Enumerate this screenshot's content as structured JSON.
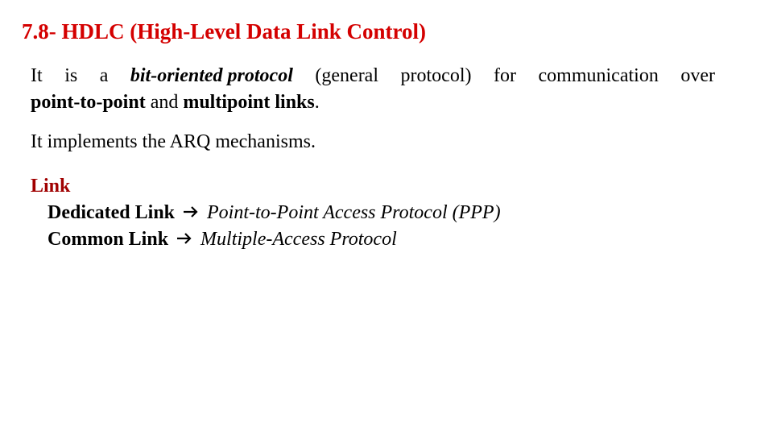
{
  "slide": {
    "title": "7.8- HDLC (High-Level Data Link Control)",
    "title_color": "#d40000",
    "paragraph1": {
      "words_line1": [
        "It",
        "is",
        "a",
        "bit-oriented protocol",
        "(general",
        "protocol)",
        "for",
        "communication",
        "over"
      ],
      "bold_italic_phrase": "bit-oriented protocol",
      "line2_bold1": "point-to-point",
      "line2_and": " and ",
      "line2_bold2": "multipoint links",
      "line2_end": "."
    },
    "paragraph2": "It implements the ARQ mechanisms.",
    "link_section": {
      "heading": "Link",
      "heading_color": "#a00000",
      "items": [
        {
          "label": "Dedicated Link",
          "arrow_icon": "right-arrow",
          "target": "Point-to-Point Access Protocol (PPP)"
        },
        {
          "label": "Common Link",
          "arrow_icon": "right-arrow",
          "target": "Multiple-Access Protocol"
        }
      ]
    }
  }
}
